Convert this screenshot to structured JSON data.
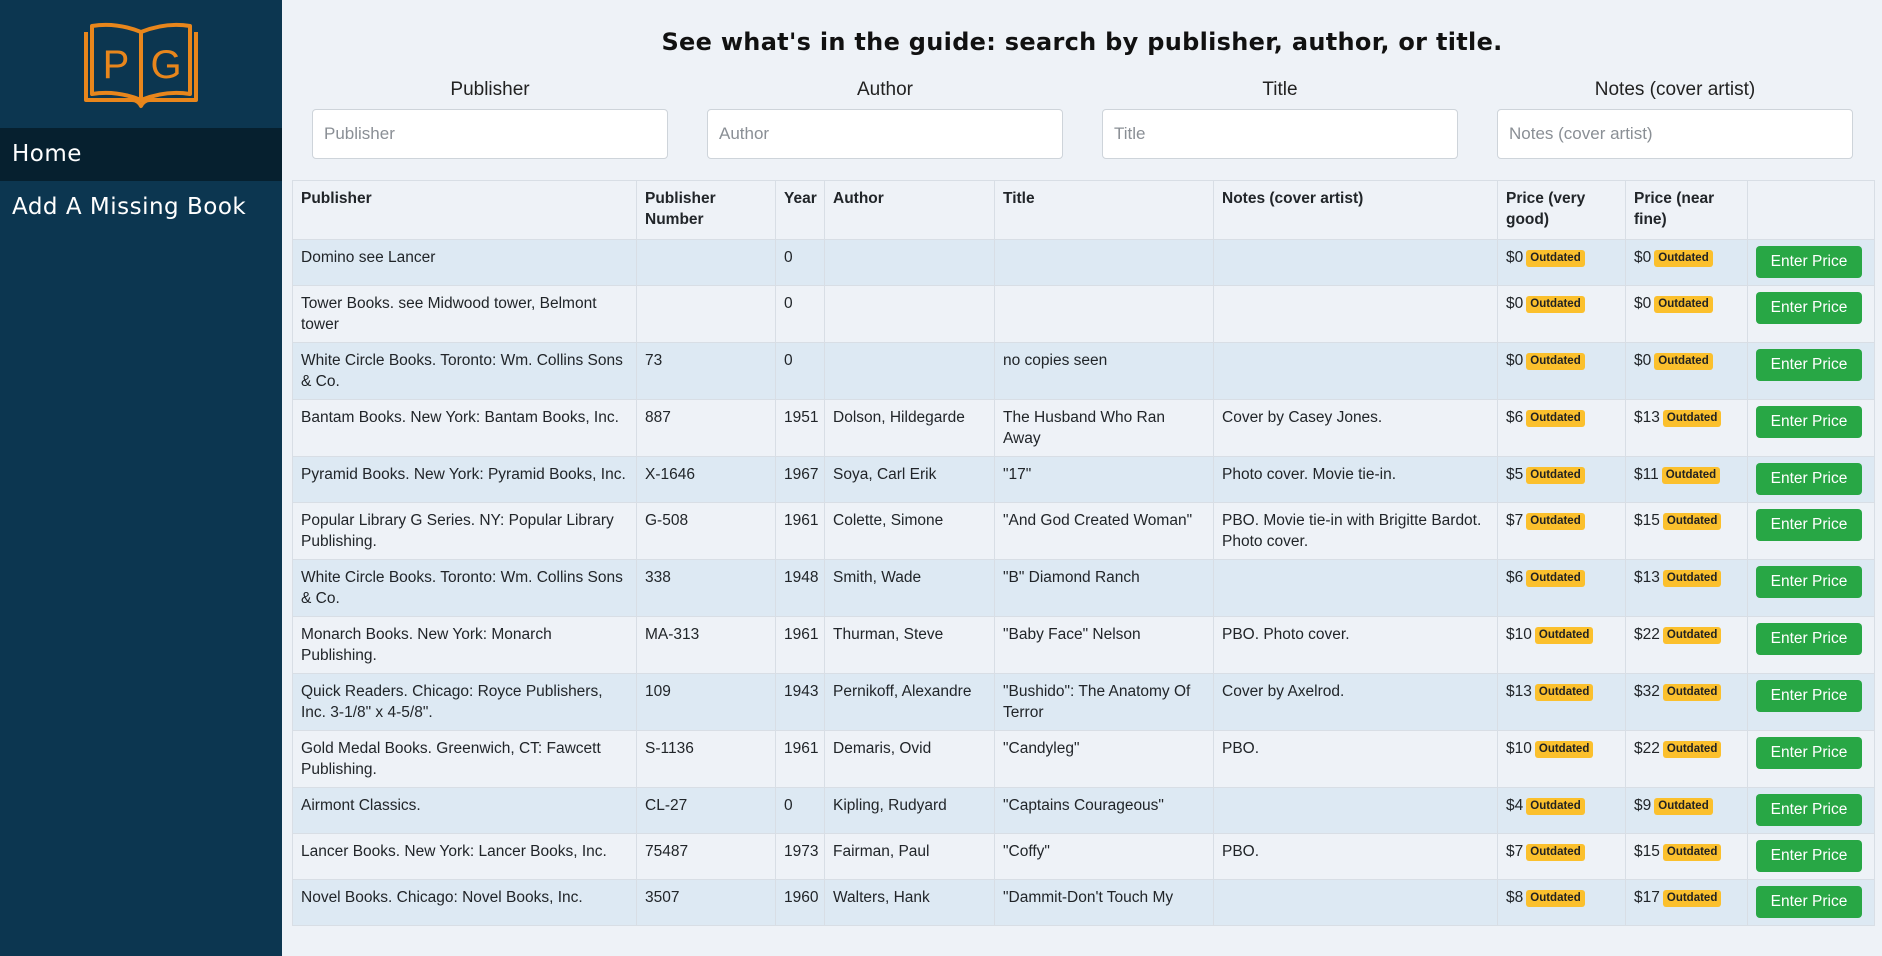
{
  "logo": {
    "text": "PG",
    "color": "#e8861c"
  },
  "nav": [
    {
      "label": "Home",
      "active": true
    },
    {
      "label": "Add A Missing Book",
      "active": false
    }
  ],
  "header": {
    "title": "See what's in the guide: search by publisher, author, or title."
  },
  "filters": [
    {
      "label": "Publisher",
      "placeholder": "Publisher",
      "value": ""
    },
    {
      "label": "Author",
      "placeholder": "Author",
      "value": ""
    },
    {
      "label": "Title",
      "placeholder": "Title",
      "value": ""
    },
    {
      "label": "Notes (cover artist)",
      "placeholder": "Notes (cover artist)",
      "value": ""
    }
  ],
  "table": {
    "columns": [
      "Publisher",
      "Publisher Number",
      "Year",
      "Author",
      "Title",
      "Notes (cover artist)",
      "Price (very good)",
      "Price (near fine)",
      ""
    ],
    "badge_label": "Outdated",
    "button_label": "Enter Price",
    "rows": [
      {
        "publisher": "Domino see Lancer",
        "number": "",
        "year": "0",
        "author": "",
        "title": "",
        "notes": "",
        "vg": "$0",
        "nf": "$0"
      },
      {
        "publisher": "Tower Books. see Midwood tower, Belmont tower",
        "number": "",
        "year": "0",
        "author": "",
        "title": "",
        "notes": "",
        "vg": "$0",
        "nf": "$0"
      },
      {
        "publisher": "White Circle Books. Toronto: Wm. Collins Sons & Co.",
        "number": "73",
        "year": "0",
        "author": "",
        "title": "no copies seen",
        "notes": "",
        "vg": "$0",
        "nf": "$0"
      },
      {
        "publisher": "Bantam Books. New York: Bantam Books, Inc.",
        "number": "887",
        "year": "1951",
        "author": "Dolson, Hildegarde",
        "title": "The Husband Who Ran Away",
        "notes": "Cover by Casey Jones.",
        "vg": "$6",
        "nf": "$13"
      },
      {
        "publisher": "Pyramid Books. New York: Pyramid Books, Inc.",
        "number": "X-1646",
        "year": "1967",
        "author": "Soya, Carl Erik",
        "title": "\"17\"",
        "notes": "Photo cover. Movie tie-in.",
        "vg": "$5",
        "nf": "$11"
      },
      {
        "publisher": "Popular Library G Series. NY: Popular Library Publishing.",
        "number": "G-508",
        "year": "1961",
        "author": "Colette, Simone",
        "title": "\"And God Created Woman\"",
        "notes": "PBO. Movie tie-in with Brigitte Bardot. Photo cover.",
        "vg": "$7",
        "nf": "$15"
      },
      {
        "publisher": "White Circle Books. Toronto: Wm. Collins Sons & Co.",
        "number": "338",
        "year": "1948",
        "author": "Smith, Wade",
        "title": "\"B\" Diamond Ranch",
        "notes": "",
        "vg": "$6",
        "nf": "$13"
      },
      {
        "publisher": "Monarch Books. New York: Monarch Publishing.",
        "number": "MA-313",
        "year": "1961",
        "author": "Thurman, Steve",
        "title": "\"Baby Face\" Nelson",
        "notes": "PBO. Photo cover.",
        "vg": "$10",
        "nf": "$22"
      },
      {
        "publisher": "Quick Readers. Chicago: Royce Publishers, Inc. 3-1/8\" x 4-5/8\".",
        "number": "109",
        "year": "1943",
        "author": "Pernikoff, Alexandre",
        "title": "\"Bushido\": The Anatomy Of Terror",
        "notes": "Cover by Axelrod.",
        "vg": "$13",
        "nf": "$32"
      },
      {
        "publisher": "Gold Medal Books. Greenwich, CT: Fawcett Publishing.",
        "number": "S-1136",
        "year": "1961",
        "author": "Demaris, Ovid",
        "title": "\"Candyleg\"",
        "notes": "PBO.",
        "vg": "$10",
        "nf": "$22"
      },
      {
        "publisher": "Airmont Classics.",
        "number": "CL-27",
        "year": "0",
        "author": "Kipling, Rudyard",
        "title": "\"Captains Courageous\"",
        "notes": "",
        "vg": "$4",
        "nf": "$9"
      },
      {
        "publisher": "Lancer Books. New York: Lancer Books, Inc.",
        "number": "75487",
        "year": "1973",
        "author": "Fairman, Paul",
        "title": "\"Coffy\"",
        "notes": "PBO.",
        "vg": "$7",
        "nf": "$15"
      },
      {
        "publisher": "Novel Books. Chicago: Novel Books, Inc.",
        "number": "3507",
        "year": "1960",
        "author": "Walters, Hank",
        "title": "\"Dammit-Don't Touch My",
        "notes": "",
        "vg": "$8",
        "nf": "$17"
      }
    ]
  }
}
